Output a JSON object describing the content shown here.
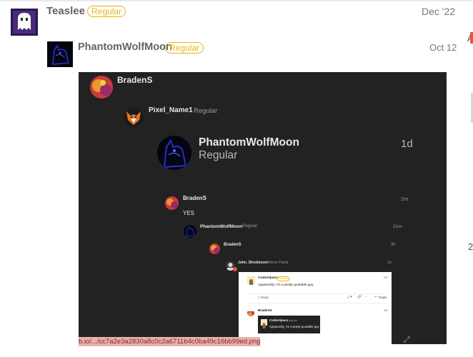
{
  "post1": {
    "username": "Teaslee",
    "badge": "Regular",
    "date": "Dec '22"
  },
  "post2": {
    "username": "PhantomWolfMoon",
    "badge": "Regular",
    "date": "Oct 12"
  },
  "edge": {
    "right_top": "A",
    "right_mid": "2"
  },
  "embed": {
    "top_user": {
      "username": "BradenS"
    },
    "reply_user": {
      "username": "Pixel_Name1",
      "title": "Regular"
    },
    "big_card": {
      "username": "PhantomWolfMoon",
      "title": "Regular",
      "time": "1d"
    },
    "thread": [
      {
        "username": "BradenS",
        "time": "2m",
        "text": "YES"
      },
      {
        "username": "PhantomWolfMoon",
        "title": "Regular",
        "time": "31m"
      },
      {
        "username": "BradenS",
        "time": "3h"
      },
      {
        "username": "John_Shrekinson",
        "title": "Meme Patrol",
        "time": "1d"
      }
    ],
    "inner_card": {
      "username": "CodeAlpaca",
      "badge": "Regular",
      "time": "5d",
      "text": "Apparently, I'm a pretty quotable guy",
      "replies": "1 Reply",
      "likes": "1",
      "reply_label": "Reply",
      "sub_username": "BradenS",
      "sub_time": "5d",
      "quote_username": "CodeAlpaca",
      "quote_title": "Regular",
      "quote_text": "Apparently, I'm a pretty quotable guy"
    },
    "url": "b.io/.../cc7a2e3a2830a8c0c2a6711b4c0ba49c16bb99ed.png"
  },
  "colors": {
    "badge": "#e7b415",
    "embed_bg": "#222222",
    "like_heart": "#e45735"
  }
}
